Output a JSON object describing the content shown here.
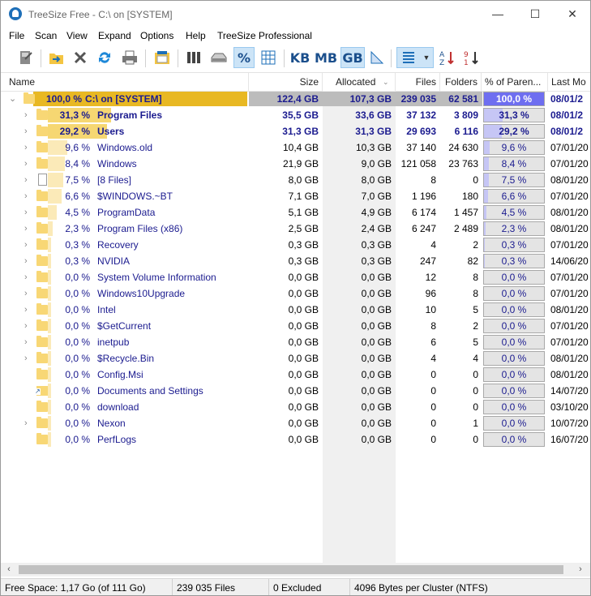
{
  "window": {
    "title": "TreeSize Free - C:\\  on  [SYSTEM]",
    "minimize": "—",
    "maximize": "☐",
    "close": "✕"
  },
  "menu": [
    "File",
    "Scan",
    "View",
    "Expand",
    "Options",
    "Help",
    "TreeSize Professional"
  ],
  "toolbar": {
    "kb": "KB",
    "mb": "MB",
    "gb": "GB",
    "percent": "%",
    "selected_unit": "GB"
  },
  "columns": {
    "name": "Name",
    "size": "Size",
    "allocated": "Allocated",
    "files": "Files",
    "folders": "Folders",
    "percent": "% of Paren...",
    "last_modified": "Last Mo"
  },
  "root": {
    "percent": "100,0 %",
    "name": "C:\\  on  [SYSTEM]",
    "size": "122,4 GB",
    "allocated": "107,3 GB",
    "files": "239 035",
    "folders": "62 581",
    "pct_parent": "100,0 %",
    "pct_value": 100,
    "date": "08/01/2"
  },
  "rows": [
    {
      "percent": "31,3 %",
      "name": "Program Files",
      "size": "35,5 GB",
      "allocated": "33,6 GB",
      "files": "37 132",
      "folders": "3 809",
      "pct_parent": "31,3 %",
      "pct_value": 31.3,
      "date": "08/01/2",
      "icon": "folder",
      "expandable": true,
      "bold": true
    },
    {
      "percent": "29,2 %",
      "name": "Users",
      "size": "31,3 GB",
      "allocated": "31,3 GB",
      "files": "29 693",
      "folders": "6 116",
      "pct_parent": "29,2 %",
      "pct_value": 29.2,
      "date": "08/01/2",
      "icon": "folder",
      "expandable": true,
      "bold": true
    },
    {
      "percent": "9,6 %",
      "name": "Windows.old",
      "size": "10,4 GB",
      "allocated": "10,3 GB",
      "files": "37 140",
      "folders": "24 630",
      "pct_parent": "9,6 %",
      "pct_value": 9.6,
      "date": "07/01/20",
      "icon": "folder",
      "expandable": true,
      "bold": false
    },
    {
      "percent": "8,4 %",
      "name": "Windows",
      "size": "21,9 GB",
      "allocated": "9,0 GB",
      "files": "121 058",
      "folders": "23 763",
      "pct_parent": "8,4 %",
      "pct_value": 8.4,
      "date": "07/01/20",
      "icon": "folder",
      "expandable": true,
      "bold": false
    },
    {
      "percent": "7,5 %",
      "name": "[8 Files]",
      "size": "8,0 GB",
      "allocated": "8,0 GB",
      "files": "8",
      "folders": "0",
      "pct_parent": "7,5 %",
      "pct_value": 7.5,
      "date": "08/01/20",
      "icon": "file",
      "expandable": true,
      "bold": false
    },
    {
      "percent": "6,6 %",
      "name": "$WINDOWS.~BT",
      "size": "7,1 GB",
      "allocated": "7,0 GB",
      "files": "1 196",
      "folders": "180",
      "pct_parent": "6,6 %",
      "pct_value": 6.6,
      "date": "07/01/20",
      "icon": "folder",
      "expandable": true,
      "bold": false
    },
    {
      "percent": "4,5 %",
      "name": "ProgramData",
      "size": "5,1 GB",
      "allocated": "4,9 GB",
      "files": "6 174",
      "folders": "1 457",
      "pct_parent": "4,5 %",
      "pct_value": 4.5,
      "date": "08/01/20",
      "icon": "folder",
      "expandable": true,
      "bold": false
    },
    {
      "percent": "2,3 %",
      "name": "Program Files (x86)",
      "size": "2,5 GB",
      "allocated": "2,4 GB",
      "files": "6 247",
      "folders": "2 489",
      "pct_parent": "2,3 %",
      "pct_value": 2.3,
      "date": "08/01/20",
      "icon": "folder",
      "expandable": true,
      "bold": false
    },
    {
      "percent": "0,3 %",
      "name": "Recovery",
      "size": "0,3 GB",
      "allocated": "0,3 GB",
      "files": "4",
      "folders": "2",
      "pct_parent": "0,3 %",
      "pct_value": 0.3,
      "date": "07/01/20",
      "icon": "folder",
      "expandable": true,
      "bold": false
    },
    {
      "percent": "0,3 %",
      "name": "NVIDIA",
      "size": "0,3 GB",
      "allocated": "0,3 GB",
      "files": "247",
      "folders": "82",
      "pct_parent": "0,3 %",
      "pct_value": 0.3,
      "date": "14/06/20",
      "icon": "folder",
      "expandable": true,
      "bold": false
    },
    {
      "percent": "0,0 %",
      "name": "System Volume Information",
      "size": "0,0 GB",
      "allocated": "0,0 GB",
      "files": "12",
      "folders": "8",
      "pct_parent": "0,0 %",
      "pct_value": 0,
      "date": "07/01/20",
      "icon": "folder",
      "expandable": true,
      "bold": false
    },
    {
      "percent": "0,0 %",
      "name": "Windows10Upgrade",
      "size": "0,0 GB",
      "allocated": "0,0 GB",
      "files": "96",
      "folders": "8",
      "pct_parent": "0,0 %",
      "pct_value": 0,
      "date": "07/01/20",
      "icon": "folder",
      "expandable": true,
      "bold": false
    },
    {
      "percent": "0,0 %",
      "name": "Intel",
      "size": "0,0 GB",
      "allocated": "0,0 GB",
      "files": "10",
      "folders": "5",
      "pct_parent": "0,0 %",
      "pct_value": 0,
      "date": "08/01/20",
      "icon": "folder",
      "expandable": true,
      "bold": false
    },
    {
      "percent": "0,0 %",
      "name": "$GetCurrent",
      "size": "0,0 GB",
      "allocated": "0,0 GB",
      "files": "8",
      "folders": "2",
      "pct_parent": "0,0 %",
      "pct_value": 0,
      "date": "07/01/20",
      "icon": "folder",
      "expandable": true,
      "bold": false
    },
    {
      "percent": "0,0 %",
      "name": "inetpub",
      "size": "0,0 GB",
      "allocated": "0,0 GB",
      "files": "6",
      "folders": "5",
      "pct_parent": "0,0 %",
      "pct_value": 0,
      "date": "07/01/20",
      "icon": "folder",
      "expandable": true,
      "bold": false
    },
    {
      "percent": "0,0 %",
      "name": "$Recycle.Bin",
      "size": "0,0 GB",
      "allocated": "0,0 GB",
      "files": "4",
      "folders": "4",
      "pct_parent": "0,0 %",
      "pct_value": 0,
      "date": "08/01/20",
      "icon": "folder",
      "expandable": true,
      "bold": false
    },
    {
      "percent": "0,0 %",
      "name": "Config.Msi",
      "size": "0,0 GB",
      "allocated": "0,0 GB",
      "files": "0",
      "folders": "0",
      "pct_parent": "0,0 %",
      "pct_value": 0,
      "date": "08/01/20",
      "icon": "folder",
      "expandable": false,
      "bold": false
    },
    {
      "percent": "0,0 %",
      "name": "Documents and Settings",
      "size": "0,0 GB",
      "allocated": "0,0 GB",
      "files": "0",
      "folders": "0",
      "pct_parent": "0,0 %",
      "pct_value": 0,
      "date": "14/07/20",
      "icon": "shortcut",
      "expandable": false,
      "bold": false
    },
    {
      "percent": "0,0 %",
      "name": "download",
      "size": "0,0 GB",
      "allocated": "0,0 GB",
      "files": "0",
      "folders": "0",
      "pct_parent": "0,0 %",
      "pct_value": 0,
      "date": "03/10/20",
      "icon": "folder",
      "expandable": false,
      "bold": false
    },
    {
      "percent": "0,0 %",
      "name": "Nexon",
      "size": "0,0 GB",
      "allocated": "0,0 GB",
      "files": "0",
      "folders": "1",
      "pct_parent": "0,0 %",
      "pct_value": 0,
      "date": "10/07/20",
      "icon": "folder",
      "expandable": true,
      "bold": false
    },
    {
      "percent": "0,0 %",
      "name": "PerfLogs",
      "size": "0,0 GB",
      "allocated": "0,0 GB",
      "files": "0",
      "folders": "0",
      "pct_parent": "0,0 %",
      "pct_value": 0,
      "date": "16/07/20",
      "icon": "folder",
      "expandable": false,
      "bold": false
    }
  ],
  "status": {
    "free_space": "Free Space: 1,17 Go  (of 111 Go)",
    "files": "239 035  Files",
    "excluded": "0 Excluded",
    "cluster": "4096  Bytes per Cluster (NTFS)"
  },
  "colors": {
    "root_bar": "#e8b823",
    "selected_bar": "#f6d772",
    "light_bar": "#fbeab8",
    "pct_fill": "#7b7bf2",
    "pct_fill_light": "#c6c6f5",
    "blue_text": "#1b1b8f"
  }
}
